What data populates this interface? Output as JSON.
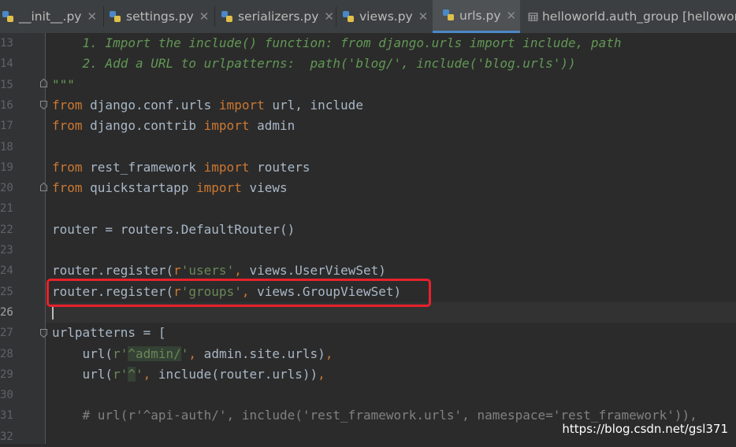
{
  "tabs": [
    {
      "label": "__init__.py",
      "icon": "python-file-icon",
      "active": false
    },
    {
      "label": "settings.py",
      "icon": "python-file-icon",
      "active": false
    },
    {
      "label": "serializers.py",
      "icon": "python-file-icon",
      "active": false
    },
    {
      "label": "views.py",
      "icon": "python-file-icon",
      "active": false
    },
    {
      "label": "urls.py",
      "icon": "python-file-icon",
      "active": true
    },
    {
      "label": "helloworld.auth_group [hellowor",
      "icon": "table-icon",
      "active": false
    }
  ],
  "editor": {
    "line_numbers": [
      "13",
      "14",
      "15",
      "16",
      "17",
      "18",
      "19",
      "20",
      "21",
      "22",
      "23",
      "24",
      "25",
      "26",
      "27",
      "28",
      "29",
      "30",
      "31",
      "32"
    ],
    "current_line": "26",
    "code": {
      "l13": "    1. Import the include() function: from django.urls import include, path",
      "l14": "    2. Add a URL to urlpatterns:  path('blog/', include('blog.urls'))",
      "l15": "\"\"\"",
      "l16": {
        "kw1": "from",
        "mod": " django.conf.urls ",
        "kw2": "import",
        "rest": " url, include"
      },
      "l17": {
        "kw1": "from",
        "mod": " django.contrib ",
        "kw2": "import",
        "rest": " admin"
      },
      "l19": {
        "kw1": "from",
        "mod": " rest_framework ",
        "kw2": "import",
        "rest": " routers"
      },
      "l20": {
        "kw1": "from",
        "mod": " quickstartapp ",
        "kw2": "import",
        "rest": " views"
      },
      "l22": "router = routers.DefaultRouter()",
      "l24": {
        "a": "router.register(",
        "prefix": "r",
        "str": "'users'",
        "comma": ",",
        "b": " views.UserViewSet)"
      },
      "l25": {
        "a": "router.register(",
        "prefix": "r",
        "str": "'groups'",
        "comma": ",",
        "b": " views.GroupViewSet)"
      },
      "l27": "urlpatterns = [",
      "l28": {
        "a": "    url(",
        "prefix": "r'",
        "hl": "^admin/",
        "q": "'",
        "comma1": ",",
        "b": " admin.site.urls)",
        "comma2": ","
      },
      "l29": {
        "a": "    url(",
        "prefix": "r'",
        "hl": "^",
        "q": "'",
        "comma1": ",",
        "b": " include(router.urls))",
        "comma2": ","
      },
      "l31": "    # url(r'^api-auth/', include('rest_framework.urls', namespace='rest_framework')),"
    }
  },
  "watermark": "https://blog.csdn.net/gsl371"
}
